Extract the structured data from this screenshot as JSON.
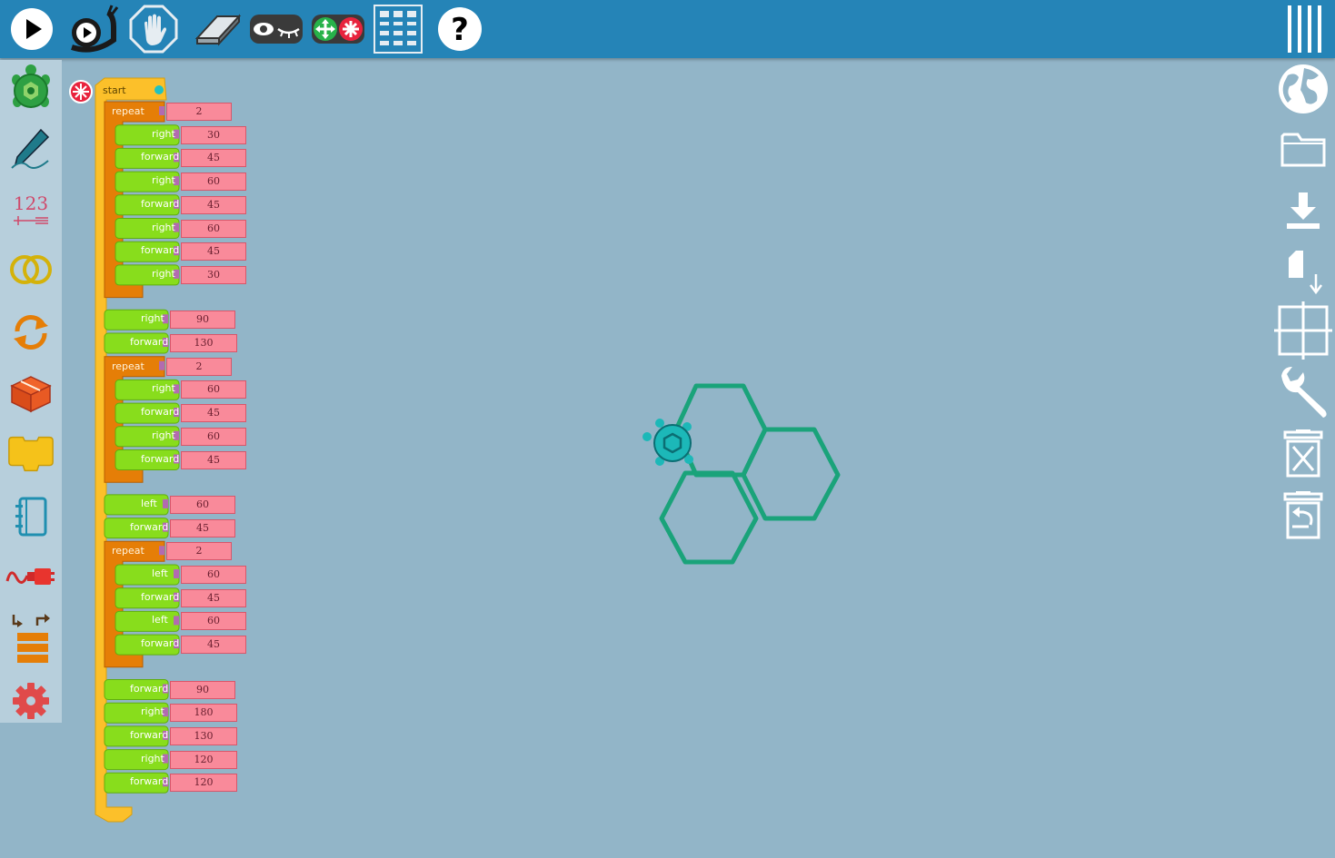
{
  "toolbar": {
    "items": [
      {
        "name": "run-fast",
        "icon": "play-icon"
      },
      {
        "name": "run-slow",
        "icon": "snail-icon"
      },
      {
        "name": "stop",
        "icon": "hand-icon"
      },
      {
        "name": "clean",
        "icon": "eraser-icon"
      },
      {
        "name": "show-hide-blocks",
        "icon": "eye-icon"
      },
      {
        "name": "expand-collapse-blocks",
        "icon": "expand-collapse-icon"
      },
      {
        "name": "home-grid",
        "icon": "grid-icon"
      },
      {
        "name": "help",
        "icon": "help-icon"
      }
    ],
    "aux_menu_icon": "hamburger-vertical-icon",
    "colors": {
      "bar": "#2584b7",
      "icon": "#ffffff"
    }
  },
  "palette": [
    {
      "name": "turtle",
      "icon": "turtle-icon"
    },
    {
      "name": "pen",
      "icon": "pen-icon"
    },
    {
      "name": "number",
      "icon": "number-icon",
      "text": "123"
    },
    {
      "name": "boolean",
      "icon": "boolean-icon"
    },
    {
      "name": "flow",
      "icon": "flow-icon"
    },
    {
      "name": "boxes",
      "icon": "boxes-icon"
    },
    {
      "name": "action",
      "icon": "action-icon"
    },
    {
      "name": "media",
      "icon": "media-icon"
    },
    {
      "name": "sensors",
      "icon": "sensors-icon"
    },
    {
      "name": "heap",
      "icon": "heap-icon"
    },
    {
      "name": "extras",
      "icon": "gear-icon"
    }
  ],
  "right_tools": [
    {
      "name": "planet",
      "icon": "globe-icon"
    },
    {
      "name": "open",
      "icon": "folder-icon"
    },
    {
      "name": "save",
      "icon": "download-icon"
    },
    {
      "name": "save-svg",
      "icon": "file-download-icon"
    },
    {
      "name": "cartesian-grid",
      "icon": "crosshair-grid-icon"
    },
    {
      "name": "settings",
      "icon": "wrench-icon"
    },
    {
      "name": "delete",
      "icon": "trash-icon"
    },
    {
      "name": "restore",
      "icon": "restore-icon"
    }
  ],
  "program": {
    "start_label": "start",
    "blocks": [
      {
        "type": "repeat",
        "label": "repeat",
        "arg": "2",
        "children": [
          {
            "label": "right",
            "arg": "30"
          },
          {
            "label": "forward",
            "arg": "45"
          },
          {
            "label": "right",
            "arg": "60"
          },
          {
            "label": "forward",
            "arg": "45"
          },
          {
            "label": "right",
            "arg": "60"
          },
          {
            "label": "forward",
            "arg": "45"
          },
          {
            "label": "right",
            "arg": "30"
          }
        ]
      },
      {
        "label": "right",
        "arg": "90"
      },
      {
        "label": "forward",
        "arg": "130"
      },
      {
        "type": "repeat",
        "label": "repeat",
        "arg": "2",
        "children": [
          {
            "label": "right",
            "arg": "60"
          },
          {
            "label": "forward",
            "arg": "45"
          },
          {
            "label": "right",
            "arg": "60"
          },
          {
            "label": "forward",
            "arg": "45"
          }
        ]
      },
      {
        "label": "left",
        "arg": "60"
      },
      {
        "label": "forward",
        "arg": "45"
      },
      {
        "type": "repeat",
        "label": "repeat",
        "arg": "2",
        "children": [
          {
            "label": "left",
            "arg": "60"
          },
          {
            "label": "forward",
            "arg": "45"
          },
          {
            "label": "left",
            "arg": "60"
          },
          {
            "label": "forward",
            "arg": "45"
          }
        ]
      },
      {
        "label": "forward",
        "arg": "90"
      },
      {
        "label": "right",
        "arg": "180"
      },
      {
        "label": "forward",
        "arg": "130"
      },
      {
        "label": "right",
        "arg": "120"
      },
      {
        "label": "forward",
        "arg": "120"
      }
    ],
    "colors": {
      "start": "#fcc02a",
      "repeat": "#e57e07",
      "turtle_block": "#88dd1c",
      "arg": "#f98a9a"
    }
  },
  "canvas": {
    "background": "#92b5c8",
    "pen_color": "#1aa37a",
    "turtle_color": "#1cb8b8"
  }
}
